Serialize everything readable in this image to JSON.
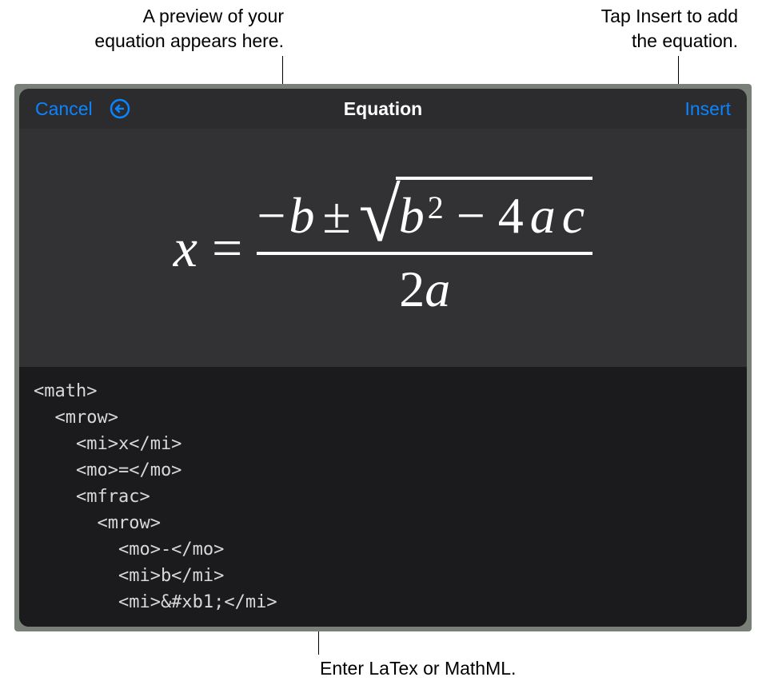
{
  "callouts": {
    "preview": "A preview of your\nequation appears here.",
    "insert": "Tap Insert to add\nthe equation.",
    "input": "Enter LaTex or MathML."
  },
  "toolbar": {
    "cancel_label": "Cancel",
    "title": "Equation",
    "insert_label": "Insert",
    "undo_icon_name": "undo-icon"
  },
  "equation": {
    "lhs": "x",
    "equals": "=",
    "numerator": {
      "neg": "−",
      "b": "b",
      "pm": "±",
      "sqrt_b": "b",
      "sqrt_exp": "2",
      "sqrt_minus": "−",
      "sqrt_4": "4",
      "sqrt_a": "a",
      "sqrt_c": "c"
    },
    "denominator": {
      "two": "2",
      "a": "a"
    }
  },
  "code_lines": [
    "<math>",
    "  <mrow>",
    "    <mi>x</mi>",
    "    <mo>=</mo>",
    "    <mfrac>",
    "      <mrow>",
    "        <mo>-</mo>",
    "        <mi>b</mi>",
    "        <mi>&#xb1;</mi>"
  ]
}
